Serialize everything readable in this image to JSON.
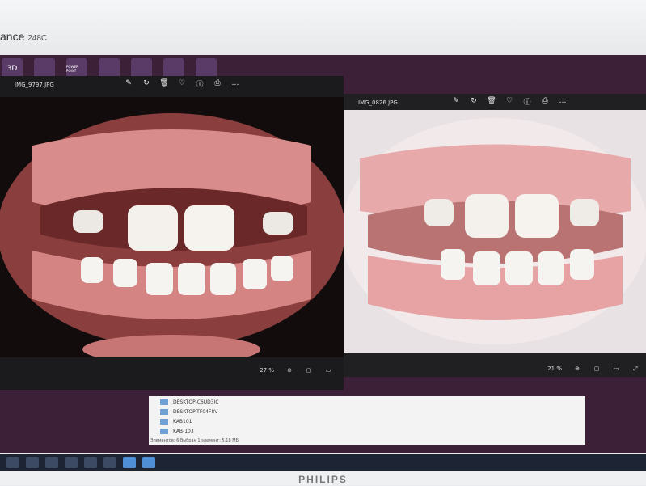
{
  "monitor": {
    "model_prefix": "ance",
    "model_number": "248C",
    "brand": "PHILIPS"
  },
  "desktop_icons": [
    {
      "label": "3D",
      "name": "3d-icon"
    },
    {
      "label": "",
      "name": "app-icon"
    },
    {
      "label": "POWER POINT",
      "name": "powerpoint-icon"
    },
    {
      "label": "",
      "name": "computer-icon"
    },
    {
      "label": "",
      "name": "computer-icon"
    },
    {
      "label": "",
      "name": "folder-icon"
    },
    {
      "label": "",
      "name": "folder-icon"
    }
  ],
  "left_viewer": {
    "title": "IMG_9797.JPG",
    "zoom": "27 %",
    "toolbar_icons": [
      "edit-icon",
      "rotate-icon",
      "delete-icon",
      "favorite-icon",
      "info-icon",
      "print-icon",
      "more-icon"
    ]
  },
  "right_viewer": {
    "title": "IMG_0826.JPG",
    "zoom": "21 %",
    "toolbar_icons": [
      "edit-icon",
      "rotate-icon",
      "delete-icon",
      "favorite-icon",
      "info-icon",
      "print-icon",
      "more-icon"
    ]
  },
  "explorer": {
    "items": [
      {
        "label": "DESKTOP-C6UD3IC"
      },
      {
        "label": "DESKTOP-TF04F8V"
      },
      {
        "label": "KAB101"
      },
      {
        "label": "KAB-103"
      }
    ],
    "status": "Элементов: 6   Выбран 1 элемент: 5.18 МБ"
  },
  "taskbar": {
    "items": [
      "start",
      "search",
      "edge",
      "explorer",
      "app",
      "settings",
      "photos",
      "paint"
    ]
  }
}
